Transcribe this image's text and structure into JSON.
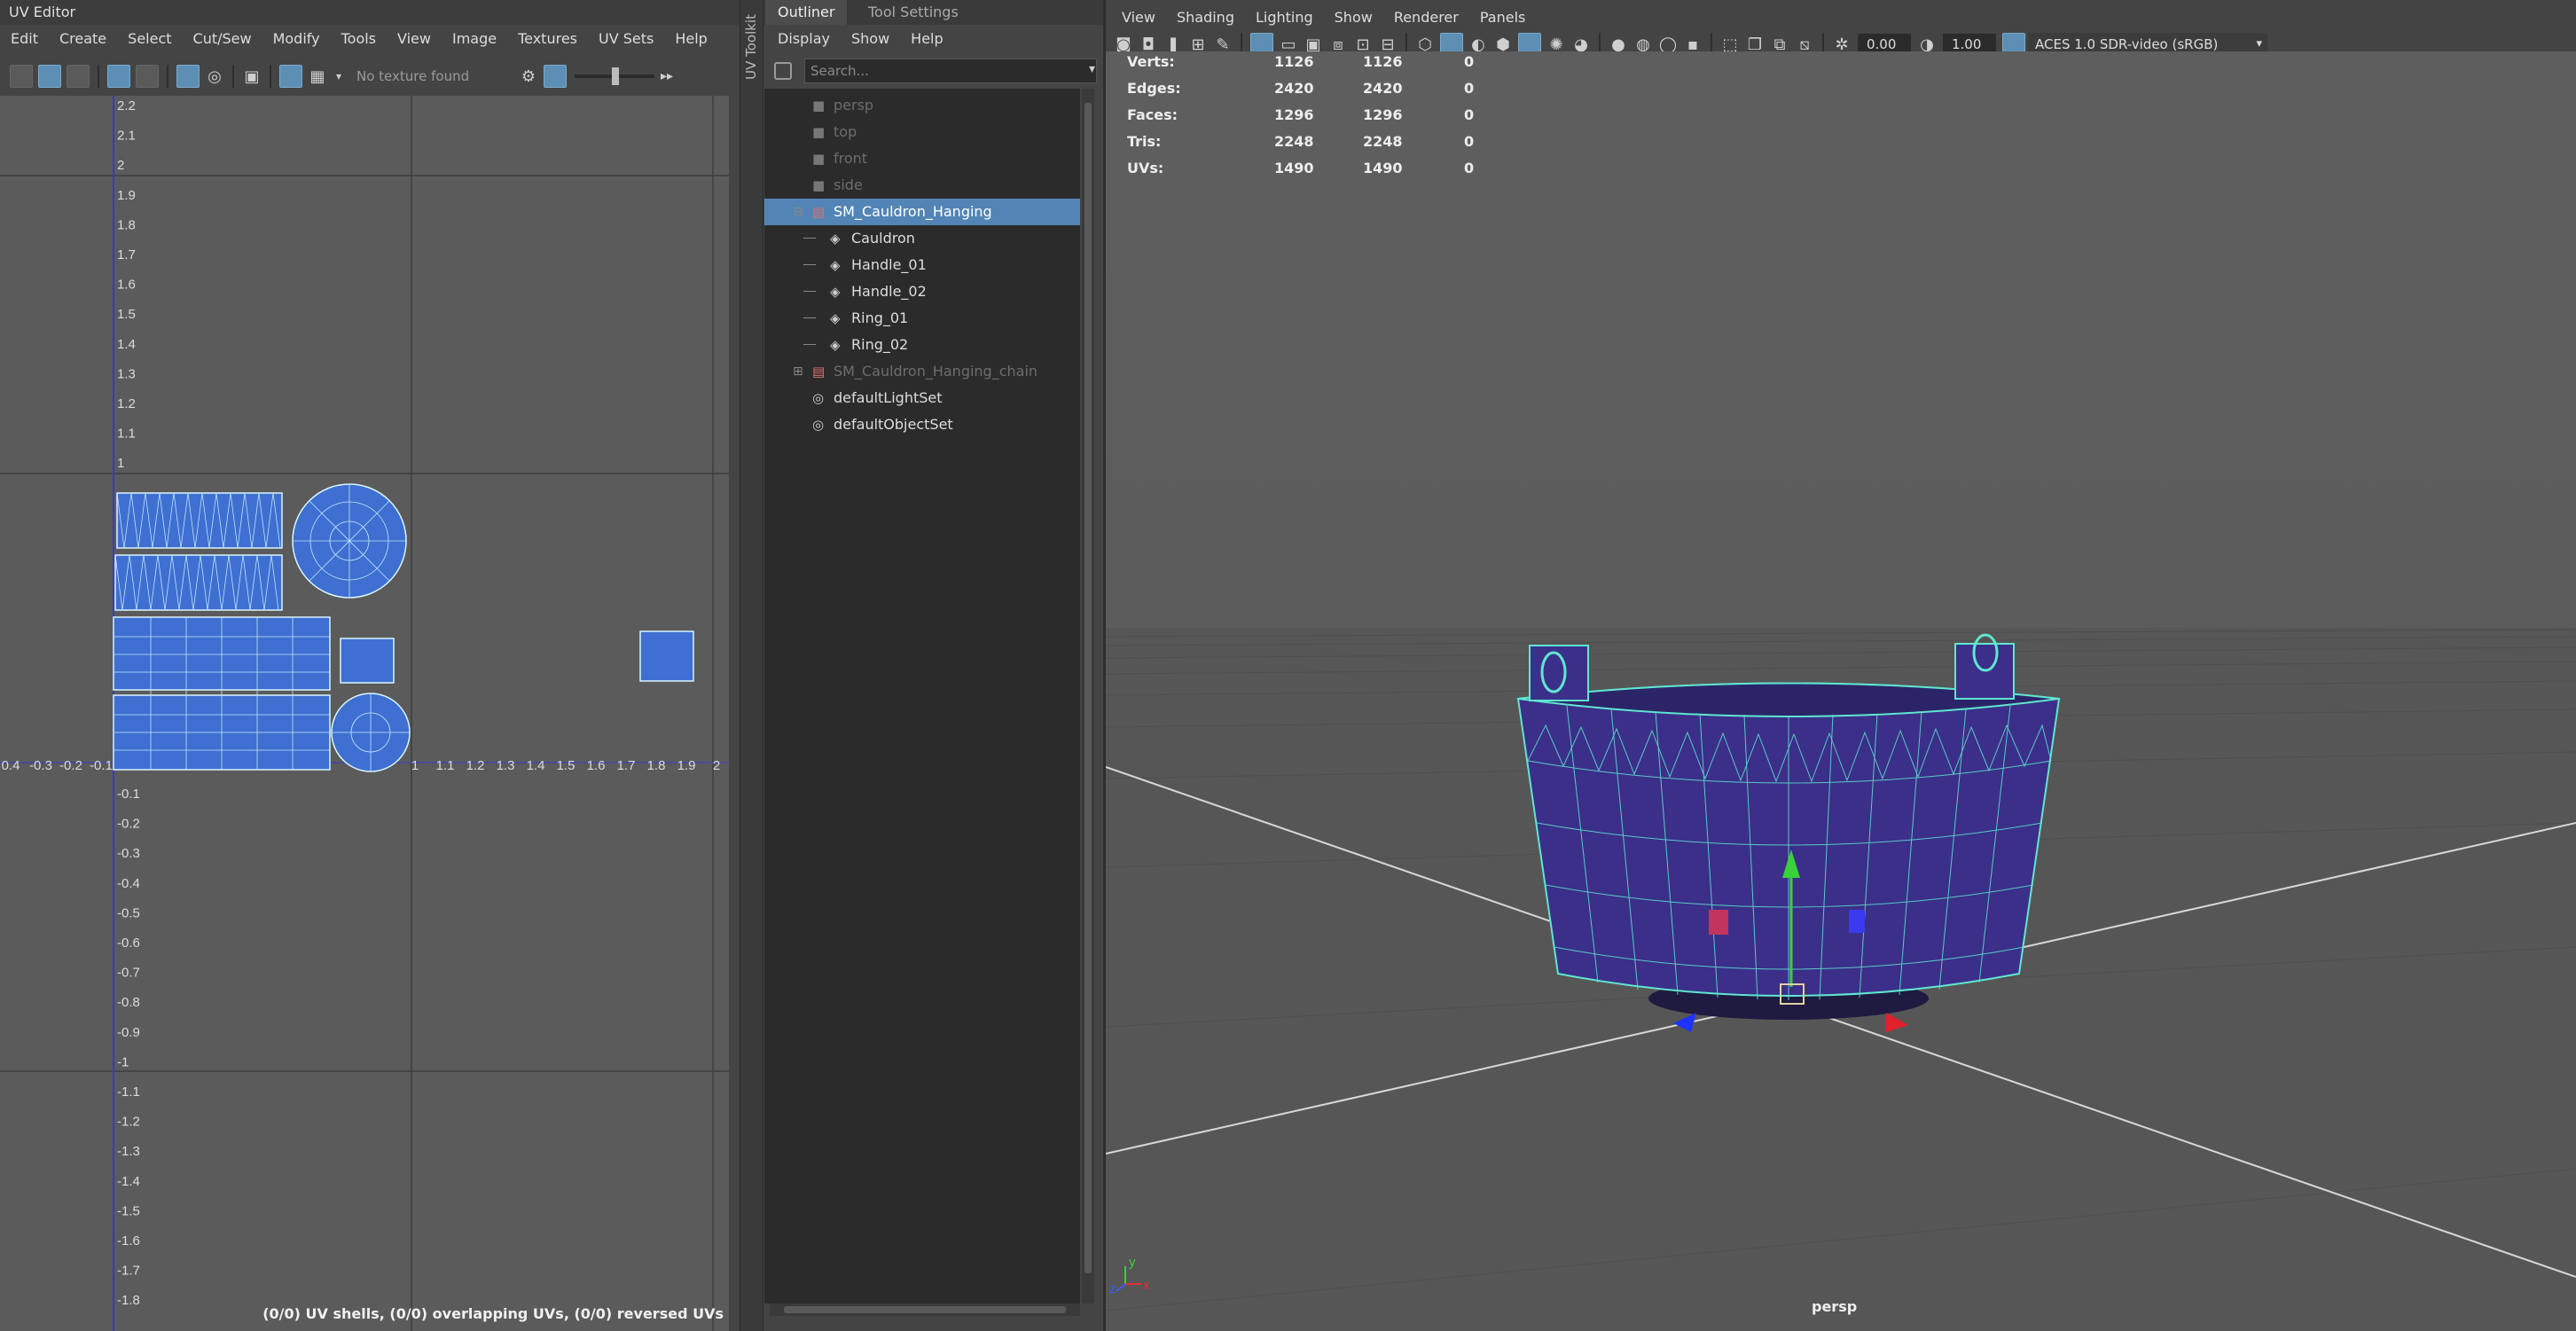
{
  "uv_editor": {
    "title": "UV Editor",
    "menu": [
      "Edit",
      "Create",
      "Select",
      "Cut/Sew",
      "Modify",
      "Tools",
      "View",
      "Image",
      "Textures",
      "UV Sets",
      "Help"
    ],
    "texture_status": "No texture found",
    "side_tab": "UV Toolkit",
    "status": "(0/0) UV shells, (0/0) overlapping UVs, (0/0) reversed UVs",
    "v_ticks_pos": [
      "2.2",
      "2.1",
      "2",
      "1.9",
      "1.8",
      "1.7",
      "1.6",
      "1.5",
      "1.4",
      "1.3",
      "1.2",
      "1.1",
      "1"
    ],
    "v_ticks_neg": [
      "-0.1",
      "-0.2",
      "-0.3",
      "-0.4",
      "-0.5",
      "-0.6",
      "-0.7",
      "-0.8",
      "-0.9",
      "-1",
      "-1.1",
      "-1.2",
      "-1.3",
      "-1.4",
      "-1.5",
      "-1.6",
      "-1.7",
      "-1.8"
    ],
    "u_ticks_neg": [
      "0.4",
      "-0.3",
      "-0.2",
      "-0.1"
    ],
    "u_ticks_pos": [
      "1",
      "1.1",
      "1.2",
      "1.3",
      "1.4",
      "1.5",
      "1.6",
      "1.7",
      "1.8",
      "1.9",
      "2"
    ]
  },
  "outliner": {
    "tabs": [
      "Outliner",
      "Tool Settings"
    ],
    "menu": [
      "Display",
      "Show",
      "Help"
    ],
    "search_placeholder": "Search...",
    "items": [
      {
        "label": "persp",
        "type": "camera",
        "dim": true
      },
      {
        "label": "top",
        "type": "camera",
        "dim": true
      },
      {
        "label": "front",
        "type": "camera",
        "dim": true
      },
      {
        "label": "side",
        "type": "camera",
        "dim": true
      },
      {
        "label": "SM_Cauldron_Hanging",
        "type": "group",
        "selected": true
      },
      {
        "label": "Cauldron",
        "type": "mesh"
      },
      {
        "label": "Handle_01",
        "type": "mesh"
      },
      {
        "label": "Handle_02",
        "type": "mesh"
      },
      {
        "label": "Ring_01",
        "type": "mesh"
      },
      {
        "label": "Ring_02",
        "type": "mesh"
      },
      {
        "label": "SM_Cauldron_Hanging_chain",
        "type": "group",
        "dim": true
      },
      {
        "label": "defaultLightSet",
        "type": "set"
      },
      {
        "label": "defaultObjectSet",
        "type": "set"
      }
    ]
  },
  "viewport": {
    "menu": [
      "View",
      "Shading",
      "Lighting",
      "Show",
      "Renderer",
      "Panels"
    ],
    "exposure": "0.00",
    "gamma": "1.00",
    "color_space": "ACES 1.0 SDR-video (sRGB)",
    "camera_label": "persp",
    "hud": [
      {
        "label": "Verts:",
        "a": "1126",
        "b": "1126",
        "c": "0"
      },
      {
        "label": "Edges:",
        "a": "2420",
        "b": "2420",
        "c": "0"
      },
      {
        "label": "Faces:",
        "a": "1296",
        "b": "1296",
        "c": "0"
      },
      {
        "label": "Tris:",
        "a": "2248",
        "b": "2248",
        "c": "0"
      },
      {
        "label": "UVs:",
        "a": "1490",
        "b": "1490",
        "c": "0"
      }
    ],
    "axis_labels": {
      "x": "x",
      "y": "y",
      "z": "z"
    }
  },
  "colors": {
    "selection": "#5285b5",
    "uv_shell": "#3f6fd0",
    "wire": "#5fe6d0",
    "mesh": "#3b2f8a"
  }
}
